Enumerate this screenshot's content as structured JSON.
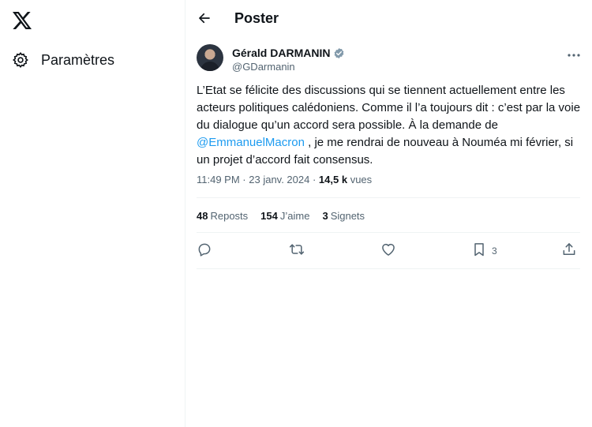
{
  "nav": {
    "logo": "x-logo",
    "settings_label": "Paramètres"
  },
  "header": {
    "title": "Poster"
  },
  "tweet": {
    "author_name": "Gérald DARMANIN",
    "author_handle": "@GDarmanin",
    "text_part1": "L’Etat se félicite des discussions qui se tiennent actuellement entre les acteurs politiques calédoniens. Comme il l’a toujours dit : c’est par la voie du dialogue qu’un accord sera possible. À la demande de ",
    "mention": "@EmmanuelMacron",
    "text_part2": " , je me rendrai de nouveau à Nouméa mi février, si un projet d’accord fait consensus.",
    "time": "11:49 PM",
    "separator": " · ",
    "date": "23 janv. 2024",
    "views_count": "14,5 k",
    "views_label": "vues",
    "reposts_count": "48",
    "reposts_label": "Reposts",
    "likes_count": "154",
    "likes_label": "J’aime",
    "bookmarks_count": "3",
    "bookmarks_label": "Signets",
    "bookmark_action_count": "3"
  },
  "colors": {
    "accent": "#1d9bf0",
    "text_primary": "#0f1419",
    "text_secondary": "#536471",
    "divider": "#eff3f4"
  },
  "icons": {
    "back": "arrow-left-icon",
    "settings": "gear-icon",
    "verified": "verified-badge-icon",
    "more": "more-horizontal-icon",
    "reply": "reply-icon",
    "repost": "repost-icon",
    "like": "heart-icon",
    "bookmark": "bookmark-icon",
    "share": "share-icon"
  }
}
